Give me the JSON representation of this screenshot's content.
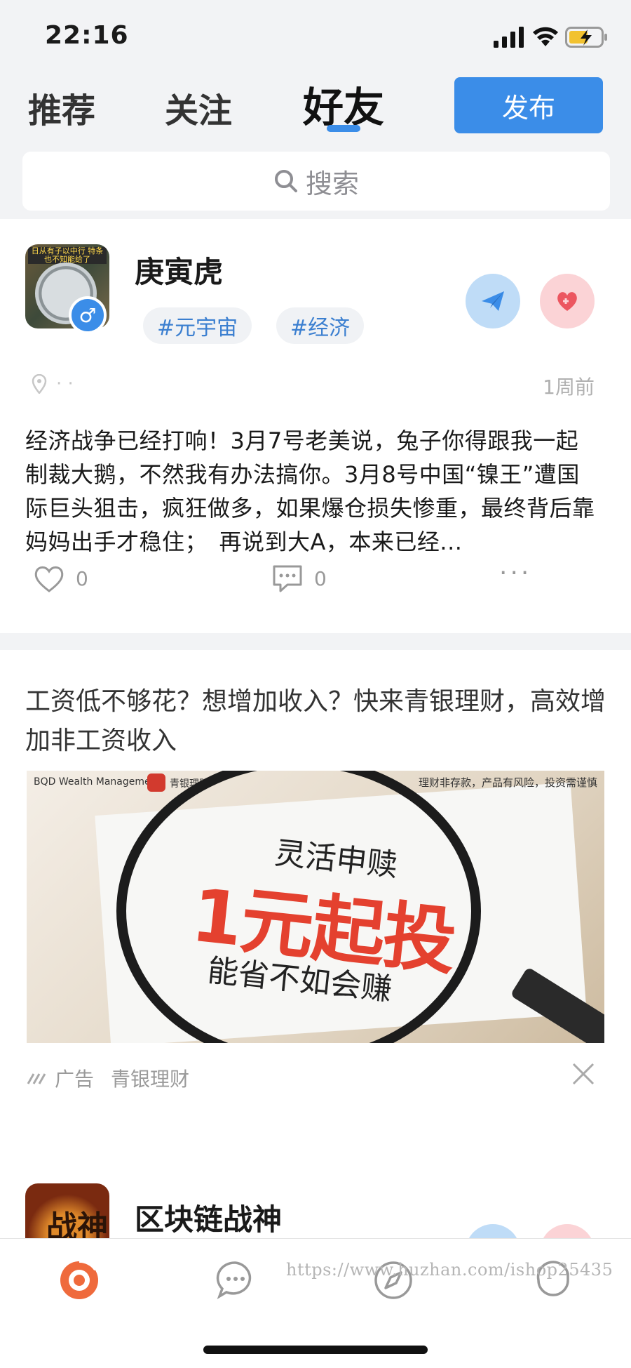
{
  "status_bar": {
    "time": "22:16"
  },
  "tabs": {
    "recommend": "推荐",
    "follow": "关注",
    "friends": "好友"
  },
  "publish_label": "发布",
  "search": {
    "placeholder": "搜索"
  },
  "post": {
    "username": "庚寅虎",
    "avatar_text": "日从有子以中行 特条也不知能给了",
    "gender_symbol": "♂",
    "tags": [
      "#元宇宙",
      "#经济"
    ],
    "location": "· ·",
    "time_ago": "1周前",
    "content": "经济战争已经打响！3月7号老美说，兔子你得跟我一起制裁大鹅，不然我有办法搞你。3月8号中国“镍王”遭国际巨头狙击，疯狂做多，如果爆仓损失惨重，最终背后靠妈妈出手才稳住；　再说到大A，本来已经...",
    "likes": "0",
    "comments": "0",
    "more": "···"
  },
  "ad": {
    "title": "工资低不够花？想增加收入？快来青银理财，高效增加非工资收入",
    "image": {
      "brand": "BQD Wealth Management",
      "brand_cn": "青银理财",
      "disclaimer": "理财非存款，产品有风险，投资需谨慎",
      "line1": "灵活申赎",
      "line2": "1元起投",
      "line3": "能省不如会赚"
    },
    "label": "广告",
    "advertiser": "青银理财"
  },
  "next_post": {
    "username": "区块链战神",
    "avatar_glyph": "战神"
  },
  "watermark": "https://www.huzhan.com/ishop25435",
  "colors": {
    "accent": "#3b8de8",
    "like_red": "#e4412f",
    "home_orange": "#ef6a3c"
  },
  "icons": {
    "status": [
      "signal-icon",
      "wifi-icon",
      "battery-charging-icon"
    ],
    "tabbar": [
      "home-icon",
      "message-icon",
      "discover-compass-icon",
      "profile-icon"
    ]
  }
}
